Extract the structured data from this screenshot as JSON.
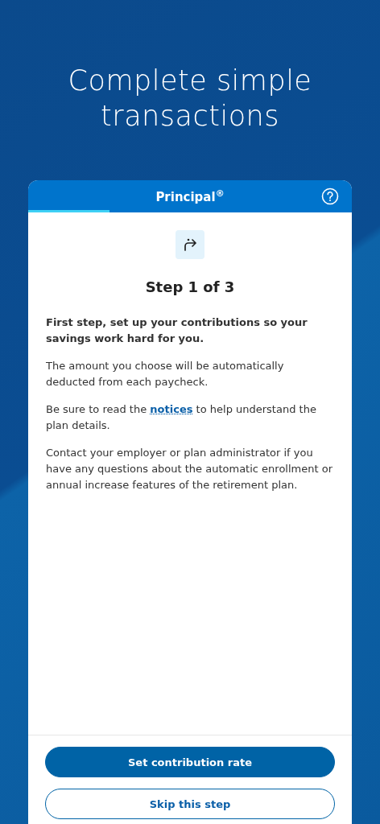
{
  "headline": "Complete simple transactions",
  "header": {
    "brand": "Principal$^{®}$",
    "progress": {
      "level": 0.25
    }
  },
  "step": {
    "title": "Step 1 of 3"
  },
  "paragraphs": [
    {
      "kind": "bold",
      "text": "First step, set up your contributions so your savings work hard for you."
    },
    {
      "kind": "plain",
      "text": "The amount you choose will be automatically deducted from each paycheck."
    },
    {
      "kind": "link",
      "before": "Be sure to read the",
      "link": "notices",
      "after": "to help understand the plan details."
    },
    {
      "kind": "plain",
      "text": "Contact your employer or plan administrator if you have any questions about the automatic enrollment or annual increase features of the retirement plan."
    }
  ],
  "buttons": [
    {
      "kind": "primary",
      "label": "Set contribution rate"
    },
    {
      "kind": "secondary",
      "label": "Skip this step"
    }
  ]
}
